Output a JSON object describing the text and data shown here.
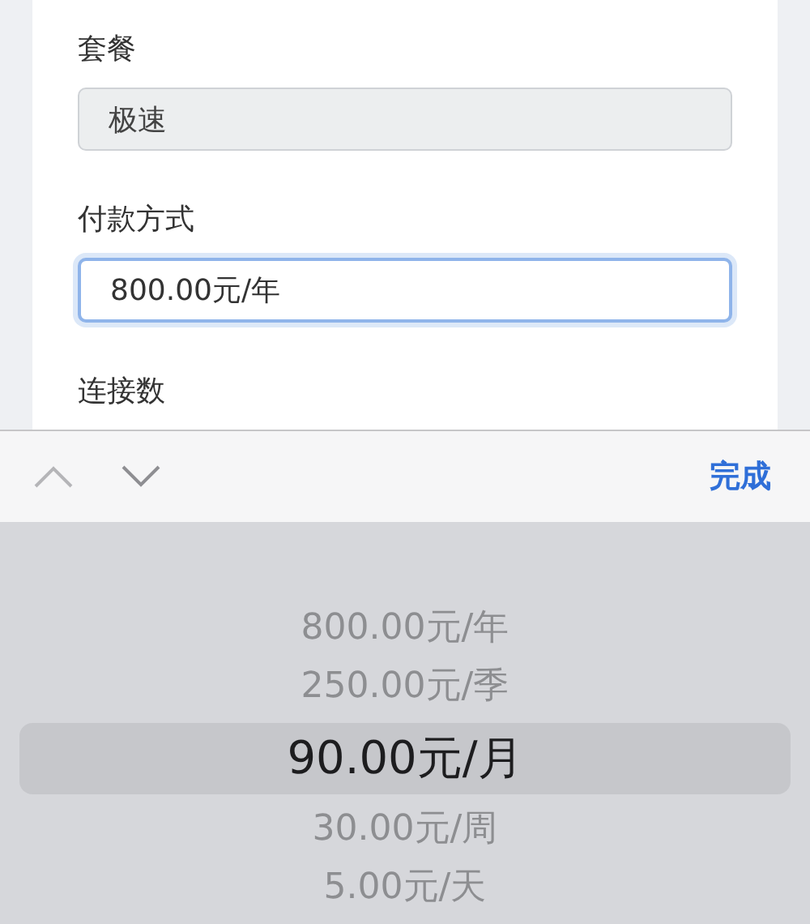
{
  "form": {
    "fields": [
      {
        "label": "套餐",
        "value": "极速",
        "disabled": true,
        "focused": false
      },
      {
        "label": "付款方式",
        "value": "800.00元/年",
        "disabled": false,
        "focused": true
      }
    ],
    "next_label": "连接数"
  },
  "toolbar": {
    "done": "完成"
  },
  "picker": {
    "options": [
      {
        "label": "800.00元/年",
        "selected": false
      },
      {
        "label": "250.00元/季",
        "selected": false
      },
      {
        "label": "90.00元/月",
        "selected": true
      },
      {
        "label": "30.00元/周",
        "selected": false
      },
      {
        "label": "5.00元/天",
        "selected": false
      }
    ]
  }
}
